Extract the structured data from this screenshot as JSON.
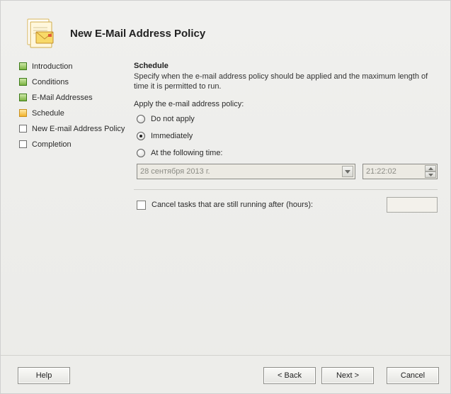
{
  "header": {
    "title": "New E-Mail Address Policy"
  },
  "sidebar": {
    "items": [
      {
        "label": "Introduction",
        "state": "visited"
      },
      {
        "label": "Conditions",
        "state": "visited"
      },
      {
        "label": "E-Mail Addresses",
        "state": "visited"
      },
      {
        "label": "Schedule",
        "state": "current"
      },
      {
        "label": "New E-mail Address Policy",
        "state": "future"
      },
      {
        "label": "Completion",
        "state": "future"
      }
    ]
  },
  "main": {
    "title": "Schedule",
    "description": "Specify when the e-mail address policy should be applied and the maximum length of time it is permitted to run.",
    "apply_label": "Apply the e-mail address policy:",
    "radios": {
      "do_not_apply": "Do not apply",
      "immediately": "Immediately",
      "at_time": "At the following time:",
      "selected": "immediately"
    },
    "date_value": "28 сентября 2013 г.",
    "time_value": "21:22:02",
    "cancel_tasks_label": "Cancel tasks that are still running after (hours):",
    "cancel_tasks_checked": false,
    "hours_value": ""
  },
  "buttons": {
    "help": "Help",
    "back": "< Back",
    "next": "Next >",
    "cancel": "Cancel"
  }
}
